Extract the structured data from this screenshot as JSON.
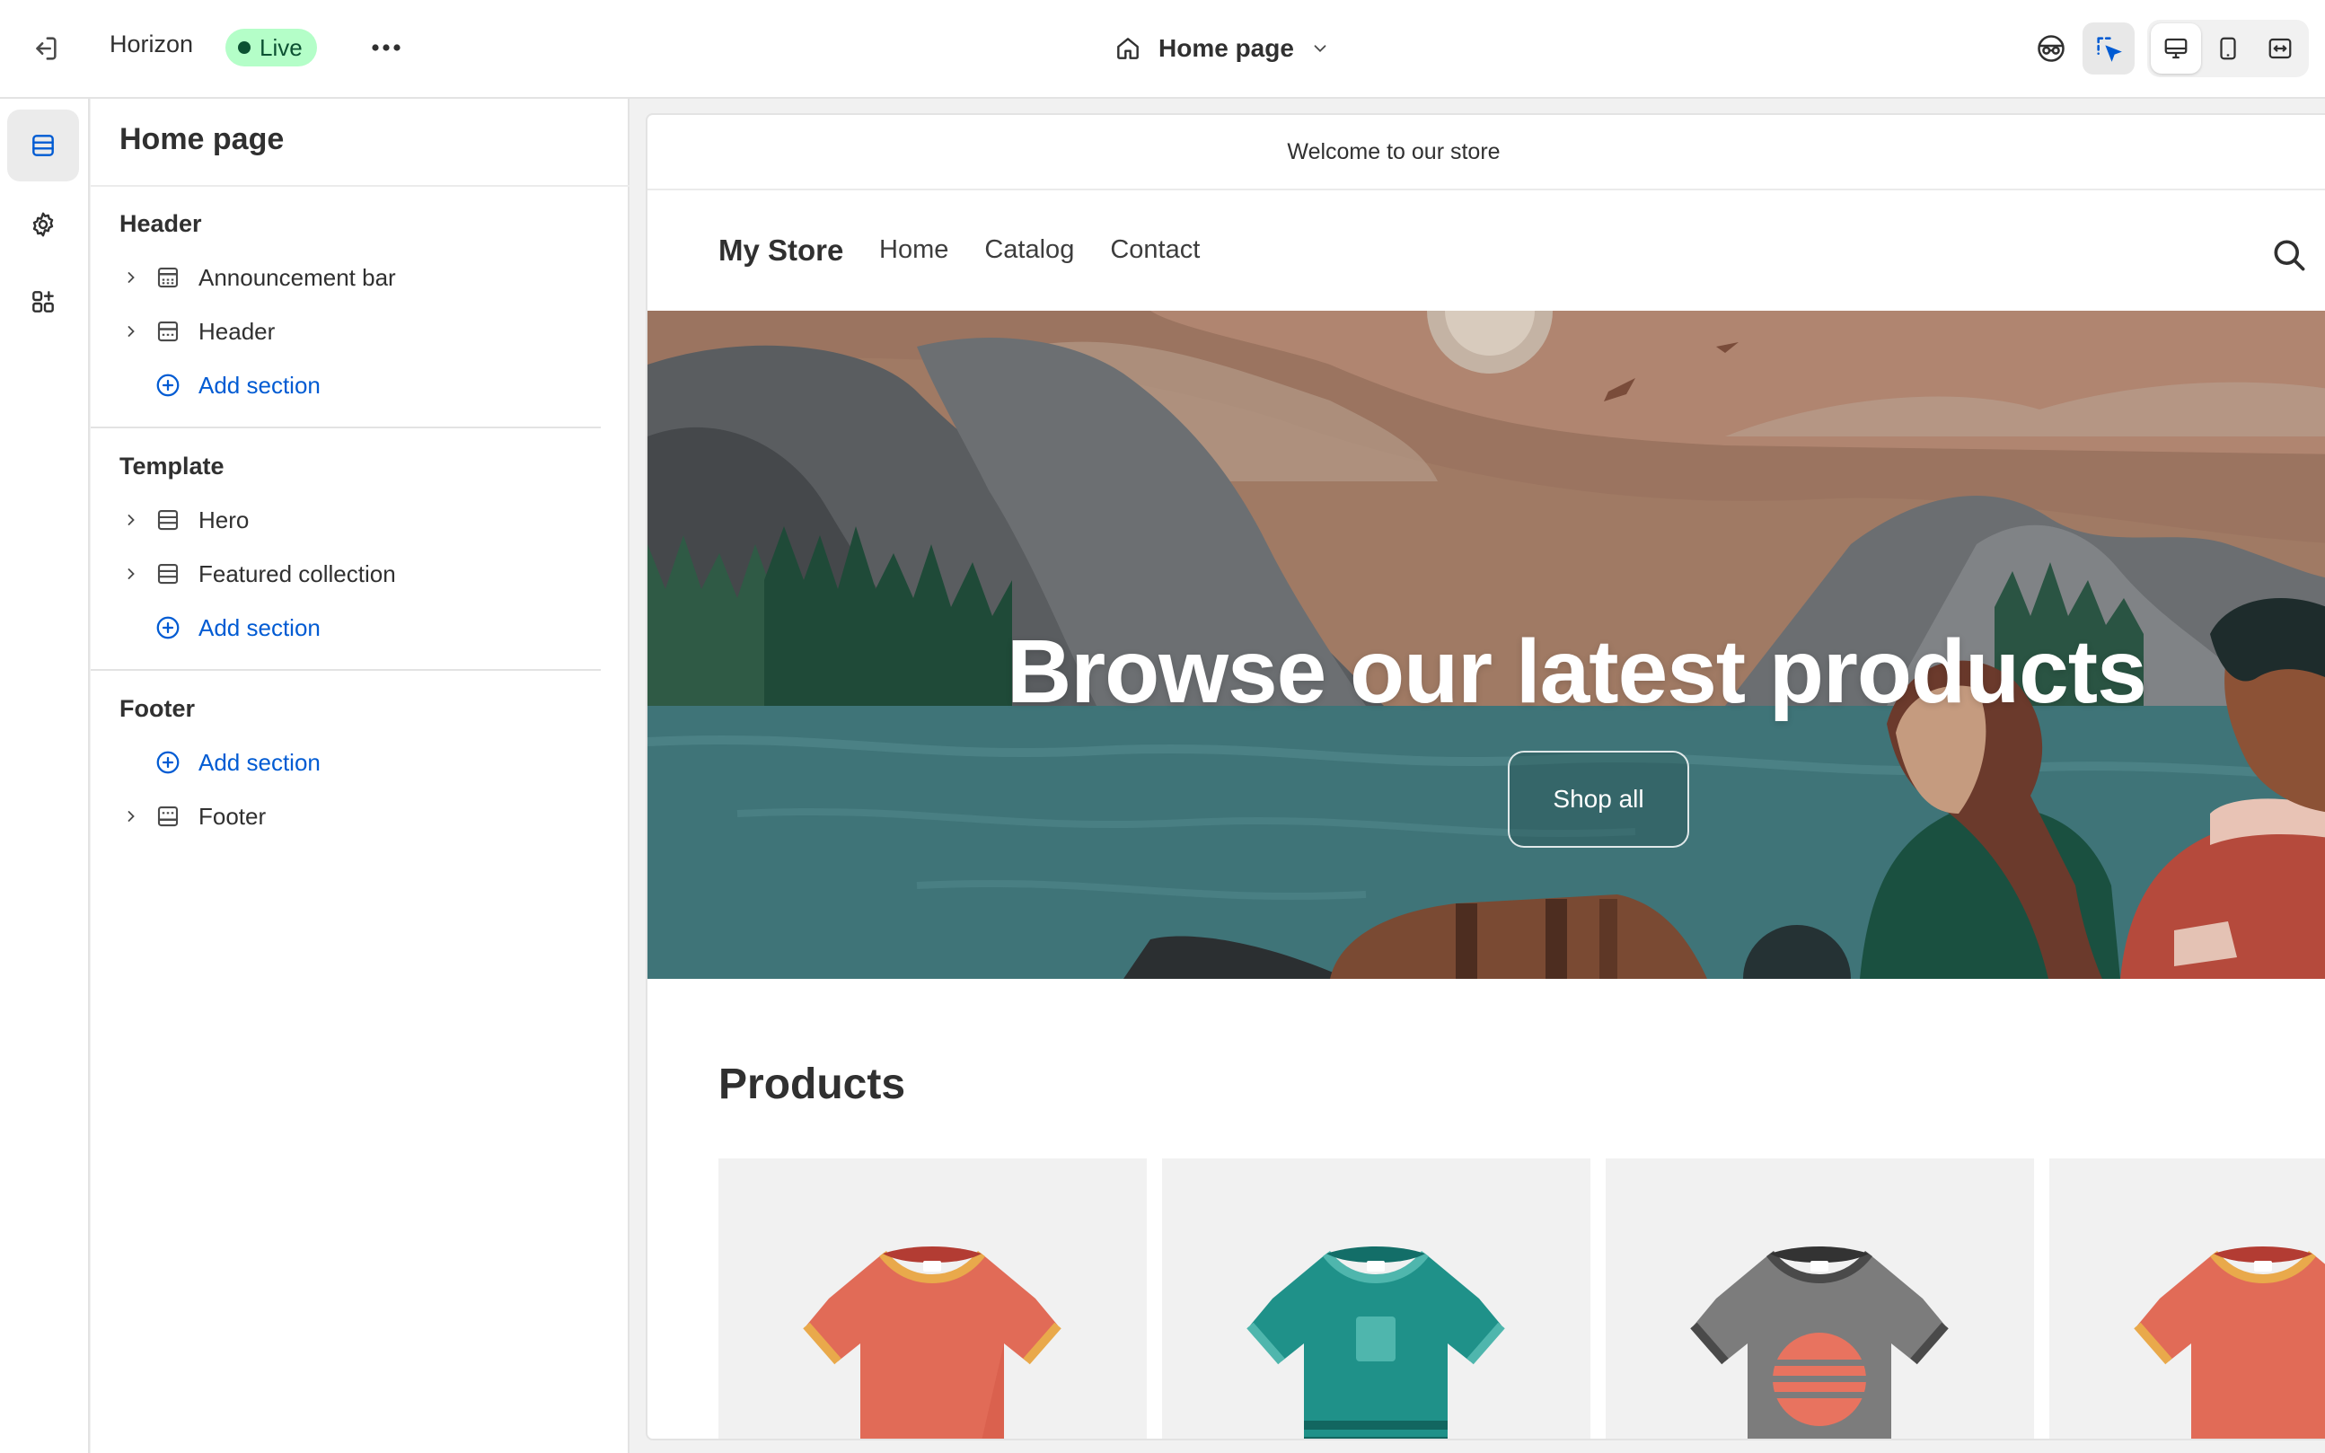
{
  "topbar": {
    "theme_name": "Horizon",
    "status_badge": "Live",
    "current_page": "Home page"
  },
  "sidebar": {
    "title": "Home page",
    "groups": [
      {
        "label": "Header",
        "items": [
          "Announcement bar",
          "Header"
        ],
        "add_label": "Add section"
      },
      {
        "label": "Template",
        "items": [
          "Hero",
          "Featured collection"
        ],
        "add_label": "Add section"
      },
      {
        "label": "Footer",
        "add_label": "Add section",
        "items": [
          "Footer"
        ]
      }
    ]
  },
  "preview": {
    "announcement": "Welcome to our store",
    "store_name": "My Store",
    "nav": [
      "Home",
      "Catalog",
      "Contact"
    ],
    "hero": {
      "heading": "Browse our latest products",
      "button": "Shop all"
    },
    "products_heading": "Products",
    "products": [
      {
        "color": "#e16b57",
        "trim": "#e9a94b"
      },
      {
        "color": "#1f9189",
        "trim": "#4fb6ad"
      },
      {
        "color": "#7c7c7c",
        "trim": "#4a4a4a"
      },
      {
        "color": "#e16b57",
        "trim": "#e9a94b"
      }
    ]
  },
  "colors": {
    "accent_blue": "#005bd3",
    "live_badge_bg": "#b4fec8",
    "live_badge_text": "#0c5132"
  },
  "icons": {
    "exit": "exit-icon",
    "more": "more-horizontal-icon",
    "page": "home-icon",
    "inspector": "inspector-icon",
    "select": "select-cursor-icon",
    "desktop": "desktop-icon",
    "mobile": "mobile-icon",
    "fullwidth": "full-width-icon",
    "sections": "sections-icon",
    "settings": "gear-icon",
    "apps": "apps-icon"
  }
}
